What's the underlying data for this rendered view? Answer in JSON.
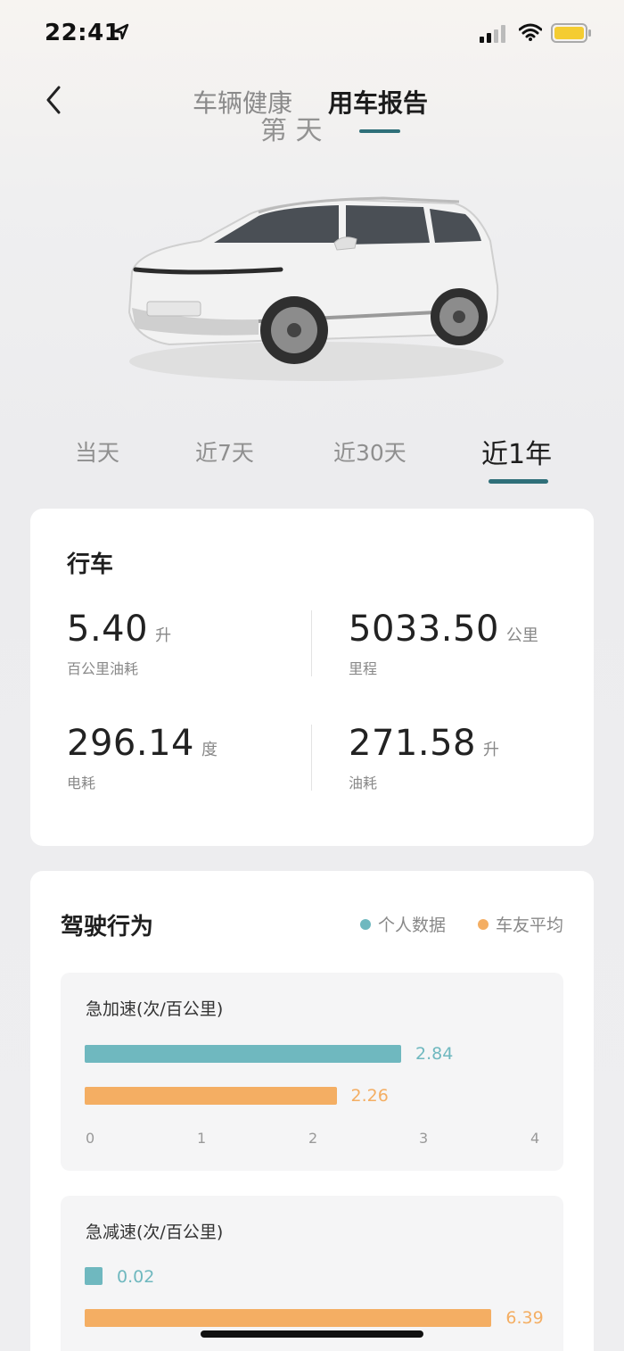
{
  "status_bar": {
    "time": "22:41"
  },
  "header": {
    "tabs": [
      {
        "label": "车辆健康",
        "active": false
      },
      {
        "label": "用车报告",
        "active": true
      }
    ],
    "day_count_fragment": "第 天"
  },
  "period_tabs": [
    {
      "label": "当天",
      "active": false
    },
    {
      "label": "近7天",
      "active": false
    },
    {
      "label": "近30天",
      "active": false
    },
    {
      "label": "近1年",
      "active": true
    }
  ],
  "driving": {
    "title": "行车",
    "metrics": [
      {
        "value": "5.40",
        "unit": "升",
        "label": "百公里油耗"
      },
      {
        "value": "5033.50",
        "unit": "公里",
        "label": "里程"
      },
      {
        "value": "296.14",
        "unit": "度",
        "label": "电耗"
      },
      {
        "value": "271.58",
        "unit": "升",
        "label": "油耗"
      }
    ]
  },
  "behavior": {
    "title": "驾驶行为",
    "legend": [
      {
        "label": "个人数据",
        "color": "#6fb8bf"
      },
      {
        "label": "车友平均",
        "color": "#f4ae63"
      }
    ],
    "charts": [
      {
        "title": "急加速(次/百公里)",
        "personal": "2.84",
        "average": "2.26",
        "axis_ticks": [
          "0",
          "1",
          "2",
          "3",
          "4"
        ],
        "axis_max": 4
      },
      {
        "title": "急减速(次/百公里)",
        "personal": "0.02",
        "average": "6.39",
        "axis_max": 7
      }
    ]
  },
  "chart_data": [
    {
      "type": "bar",
      "title": "急加速(次/百公里)",
      "categories": [
        "个人数据",
        "车友平均"
      ],
      "values": [
        2.84,
        2.26
      ],
      "xlim": [
        0,
        4
      ],
      "ticks": [
        0,
        1,
        2,
        3,
        4
      ]
    },
    {
      "type": "bar",
      "title": "急减速(次/百公里)",
      "categories": [
        "个人数据",
        "车友平均"
      ],
      "values": [
        0.02,
        6.39
      ]
    }
  ]
}
